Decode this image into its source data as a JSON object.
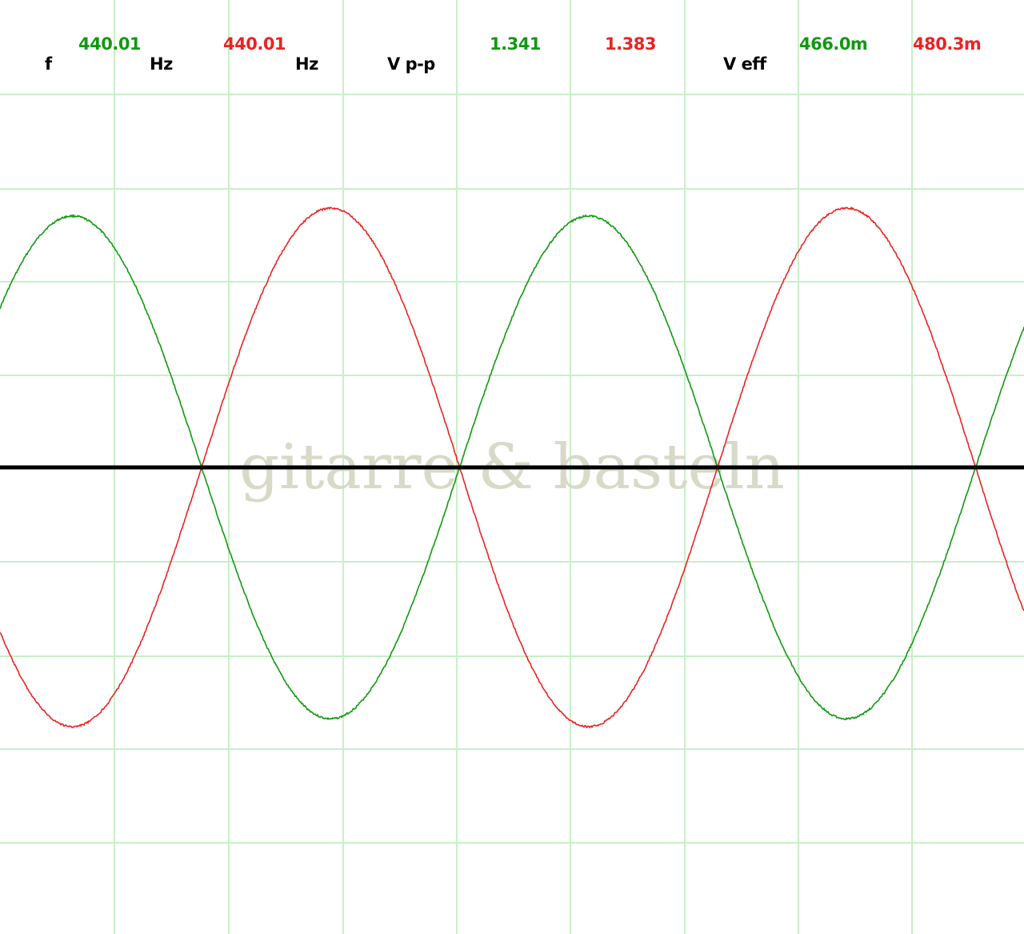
{
  "readouts": {
    "f_label": "f",
    "freq_ch1": "440.01",
    "hz_label_1": "Hz",
    "freq_ch2": "440.01",
    "hz_label_2": "Hz",
    "vpp_label": "V p-p",
    "vpp_ch1": "1.341",
    "vpp_ch2": "1.383",
    "veff_label": "V eff",
    "veff_ch1": "466.0m",
    "veff_ch2": "480.3m"
  },
  "watermark": "gitarre & basteln",
  "colors": {
    "grid": "#c8f0c8",
    "ch1": "#119911",
    "ch2": "#ee2222",
    "axis": "#000000",
    "label": "#000000",
    "watermark": "#d9d9c8"
  },
  "chart_data": {
    "type": "line",
    "grid": true,
    "frequency_hz": 440.01,
    "series": [
      {
        "color": "#119911",
        "peak_to_peak": 1.341,
        "waveform": "sine",
        "phase_deg": 180
      },
      {
        "color": "#ee2222",
        "peak_to_peak": 1.383,
        "waveform": "sine",
        "phase_deg": 0
      }
    ]
  }
}
